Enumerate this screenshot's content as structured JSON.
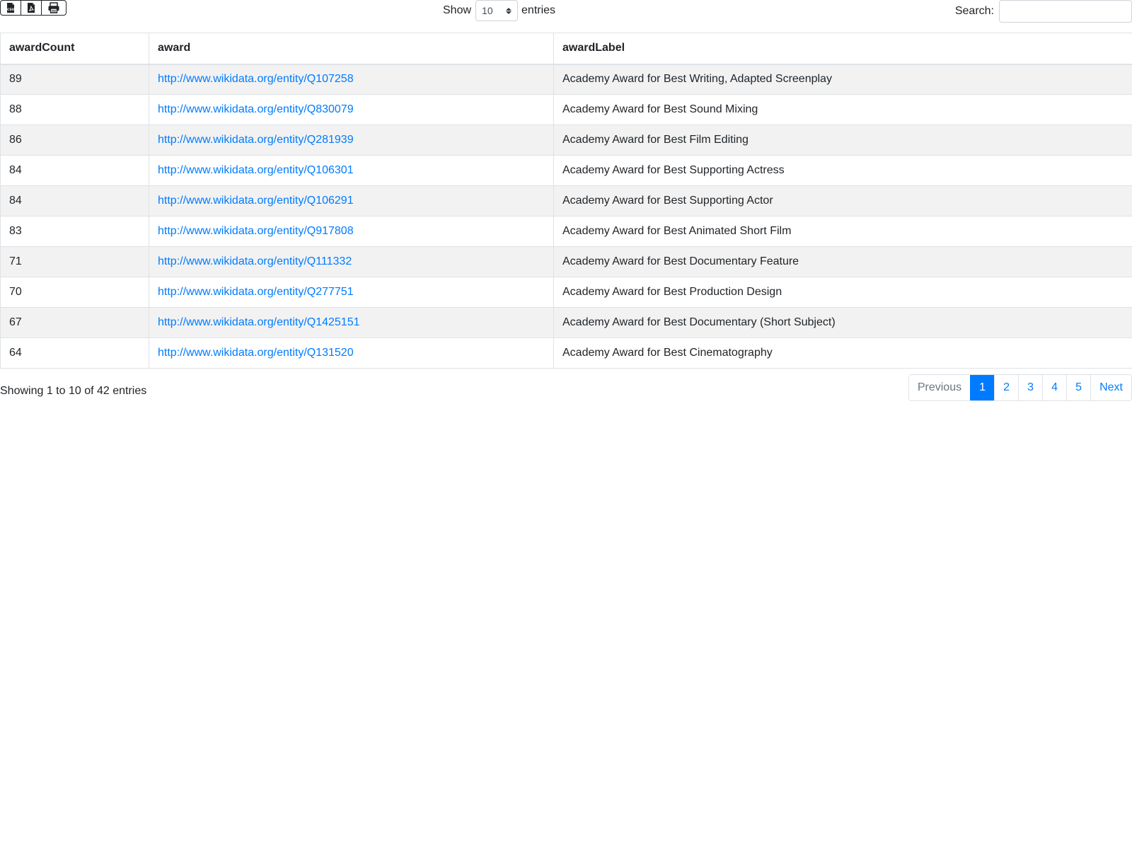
{
  "toolbar": {
    "export_icons": [
      "csv-file-icon",
      "pdf-file-icon",
      "print-icon"
    ],
    "length_prefix": "Show",
    "length_value": "10",
    "length_suffix": "entries",
    "search_label": "Search:",
    "search_value": ""
  },
  "table": {
    "headers": [
      "awardCount",
      "award",
      "awardLabel"
    ],
    "rows": [
      {
        "count": "89",
        "award": "http://www.wikidata.org/entity/Q107258",
        "label": "Academy Award for Best Writing, Adapted Screenplay"
      },
      {
        "count": "88",
        "award": "http://www.wikidata.org/entity/Q830079",
        "label": "Academy Award for Best Sound Mixing"
      },
      {
        "count": "86",
        "award": "http://www.wikidata.org/entity/Q281939",
        "label": "Academy Award for Best Film Editing"
      },
      {
        "count": "84",
        "award": "http://www.wikidata.org/entity/Q106301",
        "label": "Academy Award for Best Supporting Actress"
      },
      {
        "count": "84",
        "award": "http://www.wikidata.org/entity/Q106291",
        "label": "Academy Award for Best Supporting Actor"
      },
      {
        "count": "83",
        "award": "http://www.wikidata.org/entity/Q917808",
        "label": "Academy Award for Best Animated Short Film"
      },
      {
        "count": "71",
        "award": "http://www.wikidata.org/entity/Q111332",
        "label": "Academy Award for Best Documentary Feature"
      },
      {
        "count": "70",
        "award": "http://www.wikidata.org/entity/Q277751",
        "label": "Academy Award for Best Production Design"
      },
      {
        "count": "67",
        "award": "http://www.wikidata.org/entity/Q1425151",
        "label": "Academy Award for Best Documentary (Short Subject)"
      },
      {
        "count": "64",
        "award": "http://www.wikidata.org/entity/Q131520",
        "label": "Academy Award for Best Cinematography"
      }
    ]
  },
  "footer": {
    "info": "Showing 1 to 10 of 42 entries",
    "previous_label": "Previous",
    "next_label": "Next",
    "pages": [
      "1",
      "2",
      "3",
      "4",
      "5"
    ],
    "active_page": "1"
  },
  "colors": {
    "link": "#007bff",
    "active_page_bg": "#007bff",
    "striped_row": "#f2f2f2"
  }
}
